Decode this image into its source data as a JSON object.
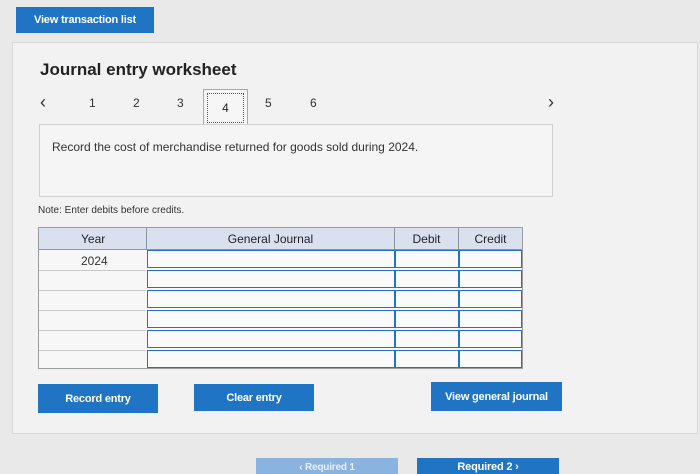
{
  "top": {
    "view_list_label": "View transaction list"
  },
  "worksheet": {
    "title": "Journal entry worksheet",
    "prev_icon": "‹",
    "next_icon": "›",
    "steps": [
      "1",
      "2",
      "3",
      "4",
      "5",
      "6"
    ],
    "current_step": "4",
    "instruction": "Record the cost of merchandise returned for goods sold during 2024.",
    "note": "Note: Enter debits before credits."
  },
  "table": {
    "headers": {
      "year": "Year",
      "journal": "General Journal",
      "debit": "Debit",
      "credit": "Credit"
    },
    "year_value": "2024"
  },
  "buttons": {
    "record": "Record entry",
    "clear": "Clear entry",
    "view_journal": "View general journal",
    "prev_required": "‹ Required 1",
    "next_required": "Required 2 ›"
  },
  "colors": {
    "accent": "#1f74c4",
    "header_bg": "#d9e1ef"
  }
}
